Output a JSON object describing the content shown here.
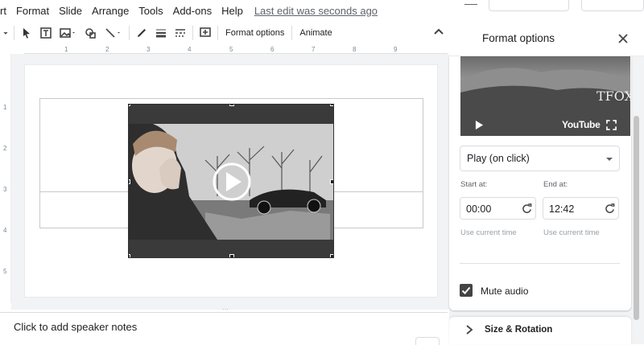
{
  "menu": {
    "items": [
      "rt",
      "Format",
      "Slide",
      "Arrange",
      "Tools",
      "Add-ons",
      "Help"
    ],
    "last_edit": "Last edit was seconds ago"
  },
  "toolbar": {
    "format_options": "Format options",
    "animate": "Animate",
    "icons": [
      "chevron-down-icon",
      "cursor-icon",
      "text-box-icon",
      "image-icon",
      "shape-icon",
      "line-icon",
      "pen-icon",
      "line-weight-icon",
      "line-dash-icon",
      "comment-add-icon",
      "collapse-icon"
    ]
  },
  "ruler": {
    "h_ticks": [
      "1",
      "2",
      "3",
      "4",
      "5",
      "6",
      "7",
      "8",
      "9"
    ],
    "v_ticks": [
      "1",
      "2",
      "3",
      "4",
      "5"
    ]
  },
  "notes": {
    "placeholder": "Click to add speaker notes"
  },
  "panel": {
    "title": "Format options",
    "video": {
      "brand": "YouTube",
      "watermark": "TFOX"
    },
    "playback": {
      "selected": "Play (on click)"
    },
    "start": {
      "label": "Start at:",
      "value": "00:00",
      "hint": "Use current time"
    },
    "end": {
      "label": "End at:",
      "value": "12:42",
      "hint": "Use current time"
    },
    "mute": {
      "label": "Mute audio",
      "checked": true
    },
    "size_rotation": "Size & Rotation"
  }
}
